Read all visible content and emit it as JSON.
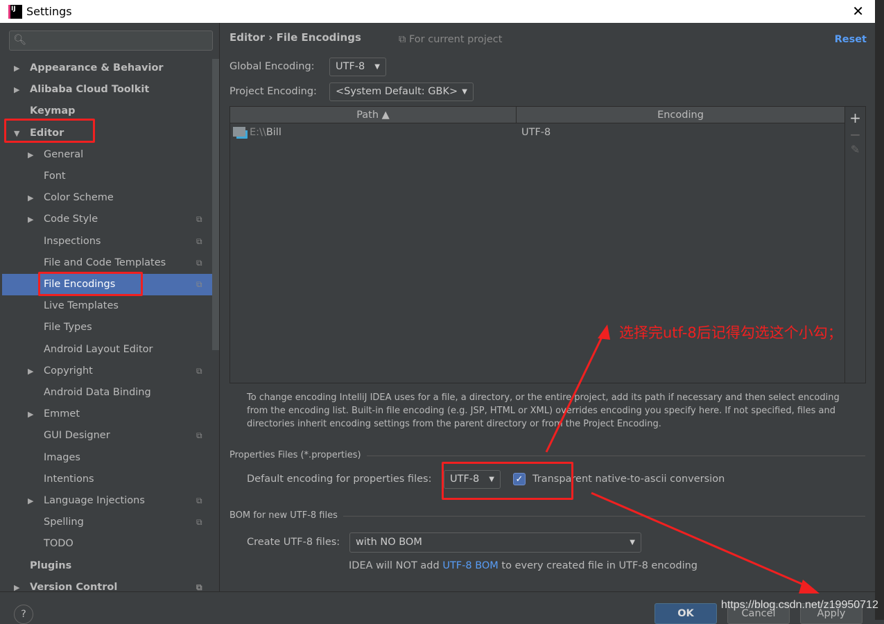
{
  "window": {
    "title": "Settings",
    "close": "✕"
  },
  "sidebar": {
    "items": [
      {
        "label": "Appearance & Behavior",
        "arrow": "▶",
        "level": 0,
        "bold": true
      },
      {
        "label": "Alibaba Cloud Toolkit",
        "arrow": "▶",
        "level": 0,
        "bold": true
      },
      {
        "label": "Keymap",
        "level": 0,
        "bold": true
      },
      {
        "label": "Editor",
        "arrow": "▼",
        "level": 0,
        "bold": true
      },
      {
        "label": "General",
        "arrow": "▶",
        "level": 1
      },
      {
        "label": "Font",
        "level": 1
      },
      {
        "label": "Color Scheme",
        "arrow": "▶",
        "level": 1
      },
      {
        "label": "Code Style",
        "arrow": "▶",
        "level": 1,
        "copy": true
      },
      {
        "label": "Inspections",
        "level": 1,
        "copy": true
      },
      {
        "label": "File and Code Templates",
        "level": 1,
        "copy": true
      },
      {
        "label": "File Encodings",
        "level": 1,
        "copy": true,
        "selected": true
      },
      {
        "label": "Live Templates",
        "level": 1
      },
      {
        "label": "File Types",
        "level": 1
      },
      {
        "label": "Android Layout Editor",
        "level": 1
      },
      {
        "label": "Copyright",
        "arrow": "▶",
        "level": 1,
        "copy": true
      },
      {
        "label": "Android Data Binding",
        "level": 1
      },
      {
        "label": "Emmet",
        "arrow": "▶",
        "level": 1
      },
      {
        "label": "GUI Designer",
        "level": 1,
        "copy": true
      },
      {
        "label": "Images",
        "level": 1
      },
      {
        "label": "Intentions",
        "level": 1
      },
      {
        "label": "Language Injections",
        "arrow": "▶",
        "level": 1,
        "copy": true
      },
      {
        "label": "Spelling",
        "level": 1,
        "copy": true
      },
      {
        "label": "TODO",
        "level": 1
      },
      {
        "label": "Plugins",
        "level": 0,
        "bold": true
      },
      {
        "label": "Version Control",
        "arrow": "▶",
        "level": 0,
        "bold": true,
        "copy": true
      }
    ]
  },
  "main": {
    "breadcrumb": "Editor  ›  File Encodings",
    "for_project": "⧉ For current project",
    "reset": "Reset",
    "global_label": "Global Encoding:",
    "global_value": "UTF-8",
    "project_label": "Project Encoding:",
    "project_value": "<System Default: GBK>",
    "table": {
      "headers": [
        "Path ▲",
        "Encoding"
      ],
      "rows": [
        {
          "path_prefix": "E:\\\\",
          "path_name": "Bill",
          "encoding": "UTF-8"
        }
      ]
    },
    "tools": {
      "add": "+",
      "remove": "−",
      "edit": "✎"
    },
    "help": "To change encoding IntelliJ IDEA uses for a file, a directory, or the entire project, add its path if necessary and then select encoding from the encoding list. Built-in file encoding (e.g. JSP, HTML or XML) overrides encoding you specify here. If not specified, files and directories inherit encoding settings from the parent directory or from the Project Encoding.",
    "props_section": "Properties Files (*.properties)",
    "props_label": "Default encoding for properties files:",
    "props_value": "UTF-8",
    "native_label": "Transparent native-to-ascii conversion",
    "native_checked": true,
    "bom_section": "BOM for new UTF-8 files",
    "bom_label": "Create UTF-8 files:",
    "bom_value": "with NO BOM",
    "bom_note_pre": "IDEA will NOT add ",
    "bom_note_link": "UTF-8 BOM",
    "bom_note_post": " to every created file in UTF-8 encoding"
  },
  "footer": {
    "help": "?",
    "ok": "OK",
    "cancel": "Cancel",
    "apply": "Apply"
  },
  "annotation": {
    "note": "选择完utf-8后记得勾选这个小勾；",
    "color": "#f02020"
  },
  "watermark": "https://blog.csdn.net/z19950712"
}
